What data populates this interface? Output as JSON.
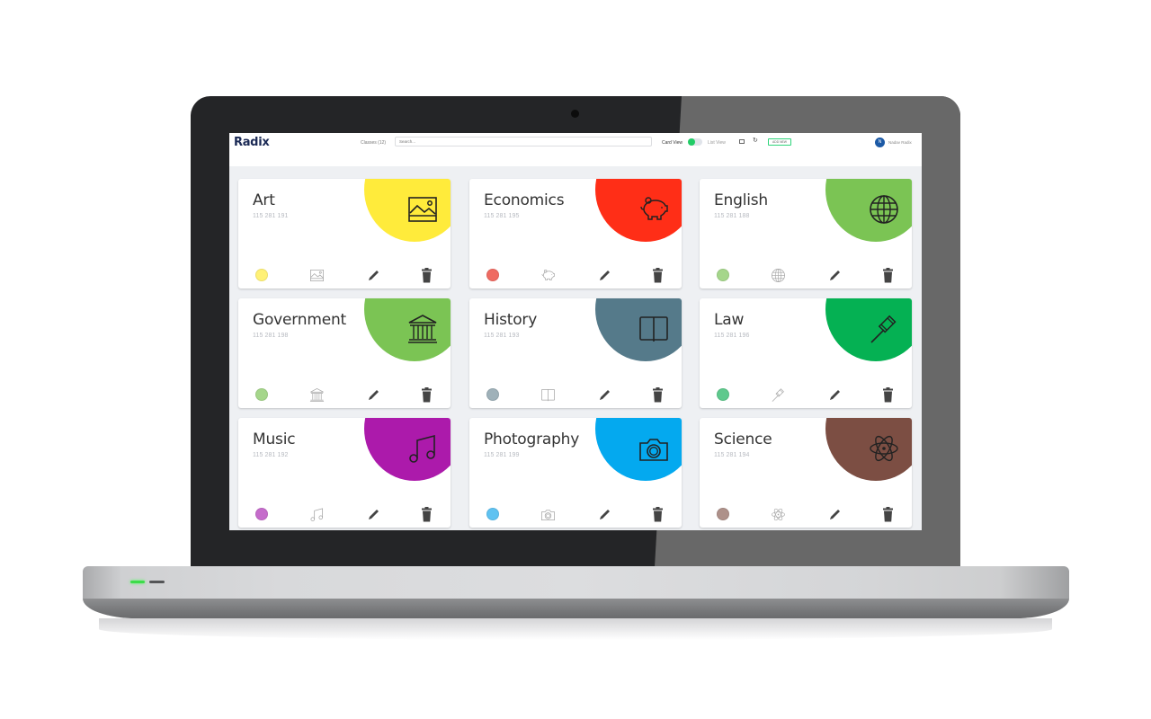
{
  "app": {
    "logo": "Radix",
    "classes_label": "Classes (12)",
    "search_placeholder": "Search...",
    "card_view_label": "Card View",
    "list_view_label": "List View",
    "add_new_label": "ADD NEW",
    "user": {
      "initial": "N",
      "name": "Nadav Radix"
    },
    "view_toggle": {
      "card_view_active": true
    }
  },
  "colors": {
    "accent_green": "#22cc66",
    "logo_navy": "#1b2a55",
    "avatar_blue": "#1d5aa6"
  },
  "cards": [
    {
      "title": "Art",
      "id": "115 281 191",
      "icon": "image-icon",
      "color": "#ffeb3b",
      "dot_color": "#fff176"
    },
    {
      "title": "Economics",
      "id": "115 281 195",
      "icon": "piggy-bank-icon",
      "color": "#ff2e17",
      "dot_color": "#ef6b62"
    },
    {
      "title": "English",
      "id": "115 281 188",
      "icon": "globe-icon",
      "color": "#7bc454",
      "dot_color": "#a5d68b"
    },
    {
      "title": "Government",
      "id": "115 281 198",
      "icon": "bank-building-icon",
      "color": "#7bc454",
      "dot_color": "#a5d68b"
    },
    {
      "title": "History",
      "id": "115 281 193",
      "icon": "book-icon",
      "color": "#557a8a",
      "dot_color": "#9fb1b9"
    },
    {
      "title": "Law",
      "id": "115 281 196",
      "icon": "gavel-icon",
      "color": "#05b153",
      "dot_color": "#5ec98d"
    },
    {
      "title": "Music",
      "id": "115 281 192",
      "icon": "music-note-icon",
      "color": "#ac1aab",
      "dot_color": "#c56ccb"
    },
    {
      "title": "Photography",
      "id": "115 281 199",
      "icon": "camera-icon",
      "color": "#04a9ef",
      "dot_color": "#5fc2f1"
    },
    {
      "title": "Science",
      "id": "115 281 194",
      "icon": "atom-icon",
      "color": "#7c4e43",
      "dot_color": "#ae918a"
    }
  ]
}
